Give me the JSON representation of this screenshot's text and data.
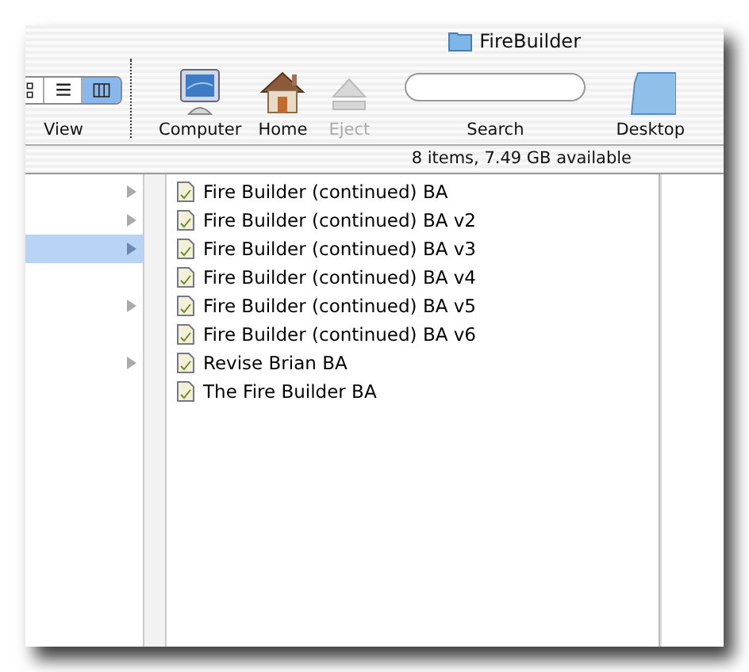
{
  "window": {
    "title": "FireBuilder"
  },
  "toolbar": {
    "view_buttons": [
      {
        "kind": "icons",
        "selected": false
      },
      {
        "kind": "list",
        "selected": false
      },
      {
        "kind": "columns",
        "selected": true
      }
    ],
    "view_label": "View",
    "items": [
      {
        "kind": "computer",
        "label": "Computer",
        "disabled": false
      },
      {
        "kind": "home",
        "label": "Home",
        "disabled": false
      },
      {
        "kind": "eject",
        "label": "Eject",
        "disabled": true
      },
      {
        "kind": "search",
        "label": "Search",
        "disabled": false
      },
      {
        "kind": "desktop",
        "label": "Desktop",
        "disabled": false
      }
    ]
  },
  "status_bar": "8 items, 7.49 GB available",
  "column_1": [
    {
      "expandable": true,
      "selected": false
    },
    {
      "expandable": true,
      "selected": false
    },
    {
      "expandable": true,
      "selected": true
    },
    {
      "expandable": false,
      "selected": false
    },
    {
      "expandable": true,
      "selected": false
    },
    {
      "expandable": false,
      "selected": false
    },
    {
      "expandable": true,
      "selected": false
    }
  ],
  "column_2": [
    {
      "name": "Fire Builder (continued) BA"
    },
    {
      "name": "Fire Builder (continued) BA v2"
    },
    {
      "name": "Fire Builder (continued) BA v3"
    },
    {
      "name": "Fire Builder (continued) BA v4"
    },
    {
      "name": "Fire Builder (continued) BA v5"
    },
    {
      "name": "Fire Builder (continued) BA v6"
    },
    {
      "name": "Revise Brian BA"
    },
    {
      "name": "The Fire Builder BA"
    }
  ]
}
